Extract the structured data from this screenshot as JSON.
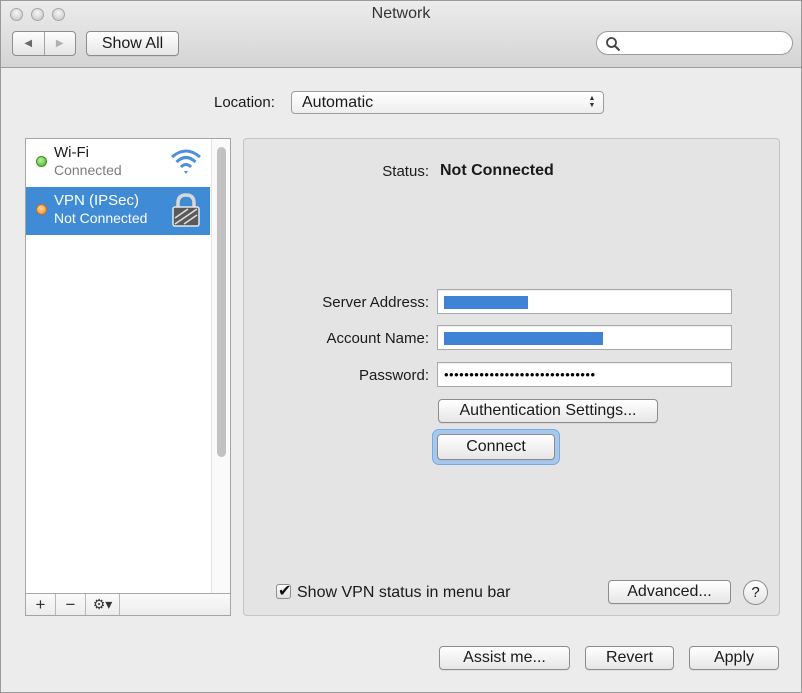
{
  "window": {
    "title": "Network"
  },
  "toolbar": {
    "back_icon": "back-arrow-icon",
    "forward_icon": "forward-arrow-icon",
    "show_all_label": "Show All",
    "search_placeholder": ""
  },
  "location": {
    "label": "Location:",
    "selected": "Automatic"
  },
  "sidebar": {
    "services": [
      {
        "name": "Wi-Fi",
        "status": "Connected",
        "status_color": "green",
        "icon": "wifi-icon",
        "selected": false
      },
      {
        "name": "VPN (IPSec)",
        "status": "Not Connected",
        "status_color": "orange",
        "icon": "lock-icon",
        "selected": true
      }
    ],
    "footer": {
      "add_label": "+",
      "remove_label": "−",
      "gear_label": "⚙▾"
    }
  },
  "detail": {
    "status_label": "Status:",
    "status_value": "Not Connected",
    "server_address_label": "Server Address:",
    "account_name_label": "Account Name:",
    "password_label": "Password:",
    "password_value": "••••••••••••••••••••••••••••••",
    "auth_settings_label": "Authentication Settings...",
    "connect_label": "Connect",
    "show_status_label": "Show VPN status in menu bar",
    "show_status_checked": true,
    "advanced_label": "Advanced...",
    "help_label": "?"
  },
  "footer": {
    "assist_label": "Assist me...",
    "revert_label": "Revert",
    "apply_label": "Apply"
  },
  "colors": {
    "selection": "#3f8bd6",
    "focus_ring": "#a6c8ee",
    "window_bg": "#ececec"
  }
}
